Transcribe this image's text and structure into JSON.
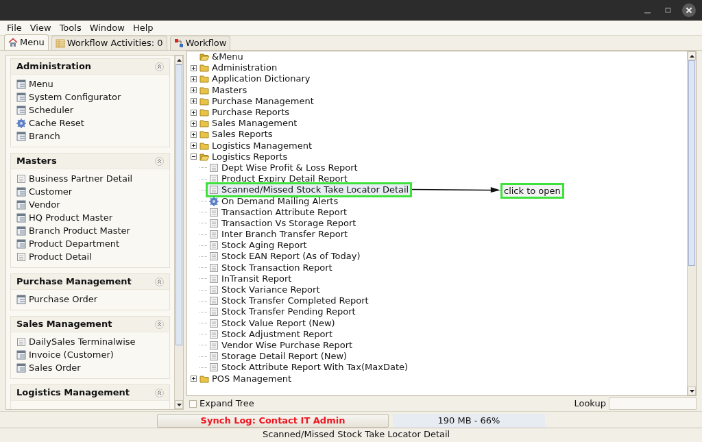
{
  "menubar": [
    {
      "label": "File"
    },
    {
      "label": "View"
    },
    {
      "label": "Tools"
    },
    {
      "label": "Window"
    },
    {
      "label": "Help"
    }
  ],
  "tabs": [
    {
      "label": "Menu",
      "selected": true
    },
    {
      "label": "Workflow Activities: 0",
      "selected": false
    },
    {
      "label": "Workflow",
      "selected": false
    }
  ],
  "sidebar": {
    "groups": [
      {
        "title": "Administration",
        "items": [
          {
            "label": "Menu",
            "kind": "window"
          },
          {
            "label": "System Configurator",
            "kind": "window"
          },
          {
            "label": "Scheduler",
            "kind": "window"
          },
          {
            "label": "Cache Reset",
            "kind": "process"
          },
          {
            "label": "Branch",
            "kind": "window"
          }
        ]
      },
      {
        "title": "Masters",
        "items": [
          {
            "label": "Business Partner Detail",
            "kind": "report"
          },
          {
            "label": "Customer",
            "kind": "window"
          },
          {
            "label": "Vendor",
            "kind": "window"
          },
          {
            "label": "HQ Product Master",
            "kind": "window"
          },
          {
            "label": "Branch Product Master",
            "kind": "window"
          },
          {
            "label": "Product Department",
            "kind": "window"
          },
          {
            "label": "Product Detail",
            "kind": "report"
          }
        ]
      },
      {
        "title": "Purchase Management",
        "items": [
          {
            "label": "Purchase Order",
            "kind": "window"
          }
        ]
      },
      {
        "title": "Sales Management",
        "items": [
          {
            "label": "DailySales Terminalwise",
            "kind": "report"
          },
          {
            "label": "Invoice (Customer)",
            "kind": "window"
          },
          {
            "label": "Sales Order",
            "kind": "window"
          }
        ]
      },
      {
        "title": "Logistics Management"
      }
    ]
  },
  "tree": {
    "label": "&Menu",
    "kind": "folder",
    "expanded": true,
    "children": [
      {
        "label": "Administration",
        "kind": "folder",
        "expanded": false
      },
      {
        "label": "Application Dictionary",
        "kind": "folder",
        "expanded": false
      },
      {
        "label": "Masters",
        "kind": "folder",
        "expanded": false
      },
      {
        "label": "Purchase Management",
        "kind": "folder",
        "expanded": false
      },
      {
        "label": "Purchase Reports",
        "kind": "folder",
        "expanded": false
      },
      {
        "label": "Sales Management",
        "kind": "folder",
        "expanded": false
      },
      {
        "label": "Sales Reports",
        "kind": "folder",
        "expanded": false
      },
      {
        "label": "Logistics Management",
        "kind": "folder",
        "expanded": false
      },
      {
        "label": "Logistics Reports",
        "kind": "folder",
        "expanded": true,
        "children": [
          {
            "label": "Dept Wise Profit & Loss Report",
            "kind": "report",
            "selected": false
          },
          {
            "label": "Product Expiry Detail Report",
            "kind": "report",
            "selected": false
          },
          {
            "label": "Scanned/Missed Stock Take Locator Detail",
            "kind": "report",
            "selected": true,
            "highlighted": true
          },
          {
            "label": "On Demand Mailing Alerts",
            "kind": "process",
            "selected": false
          },
          {
            "label": "Transaction Attribute Report",
            "kind": "report",
            "selected": false
          },
          {
            "label": "Transaction Vs Storage Report",
            "kind": "report",
            "selected": false
          },
          {
            "label": "Inter Branch Transfer Report",
            "kind": "report",
            "selected": false
          },
          {
            "label": "Stock Aging Report",
            "kind": "report",
            "selected": false
          },
          {
            "label": "Stock EAN Report (As of Today)",
            "kind": "report",
            "selected": false
          },
          {
            "label": "Stock Transaction Report",
            "kind": "report",
            "selected": false
          },
          {
            "label": "InTransit Report",
            "kind": "report",
            "selected": false
          },
          {
            "label": "Stock Variance Report",
            "kind": "report",
            "selected": false
          },
          {
            "label": "Stock Transfer Completed Report",
            "kind": "report",
            "selected": false
          },
          {
            "label": "Stock Transfer Pending Report",
            "kind": "report",
            "selected": false
          },
          {
            "label": "Stock Value Report (New)",
            "kind": "report",
            "selected": false
          },
          {
            "label": "Stock Adjustment Report",
            "kind": "report",
            "selected": false
          },
          {
            "label": "Vendor Wise Purchase Report",
            "kind": "report",
            "selected": false
          },
          {
            "label": "Storage Detail Report (New)",
            "kind": "report",
            "selected": false
          },
          {
            "label": "Stock Attribute Report With Tax(MaxDate)",
            "kind": "report",
            "selected": false
          }
        ]
      },
      {
        "label": "POS Management",
        "kind": "folder",
        "expanded": false
      }
    ]
  },
  "annotation": {
    "text": "click to open"
  },
  "expand_tree": {
    "label": "Expand Tree",
    "checked": false
  },
  "lookup": {
    "label": "Lookup"
  },
  "synch_log": "Synch Log: Contact IT Admin",
  "memory": "190 MB - 66%",
  "status_bar": "Scanned/Missed Stock Take Locator Detail"
}
